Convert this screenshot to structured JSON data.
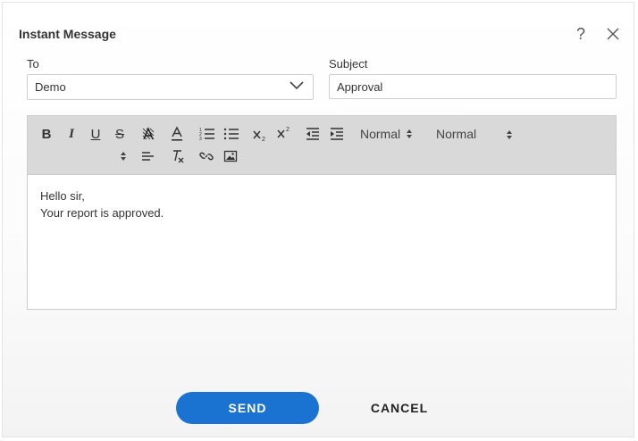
{
  "dialog": {
    "title": "Instant Message",
    "help_label": "?",
    "to": {
      "label": "To",
      "selected": "Demo"
    },
    "subject": {
      "label": "Subject",
      "value": "Approval"
    },
    "toolbar": {
      "font_size": "Normal",
      "heading": "Normal",
      "bold": "B",
      "italic": "I",
      "underline": "U",
      "strike": "S"
    },
    "message": {
      "line1": "Hello sir,",
      "line2": "Your report is approved."
    },
    "buttons": {
      "send": "SEND",
      "cancel": "CANCEL"
    },
    "colors": {
      "primary": "#1a73d1",
      "toolbar_bg": "#d9d9d9"
    }
  }
}
